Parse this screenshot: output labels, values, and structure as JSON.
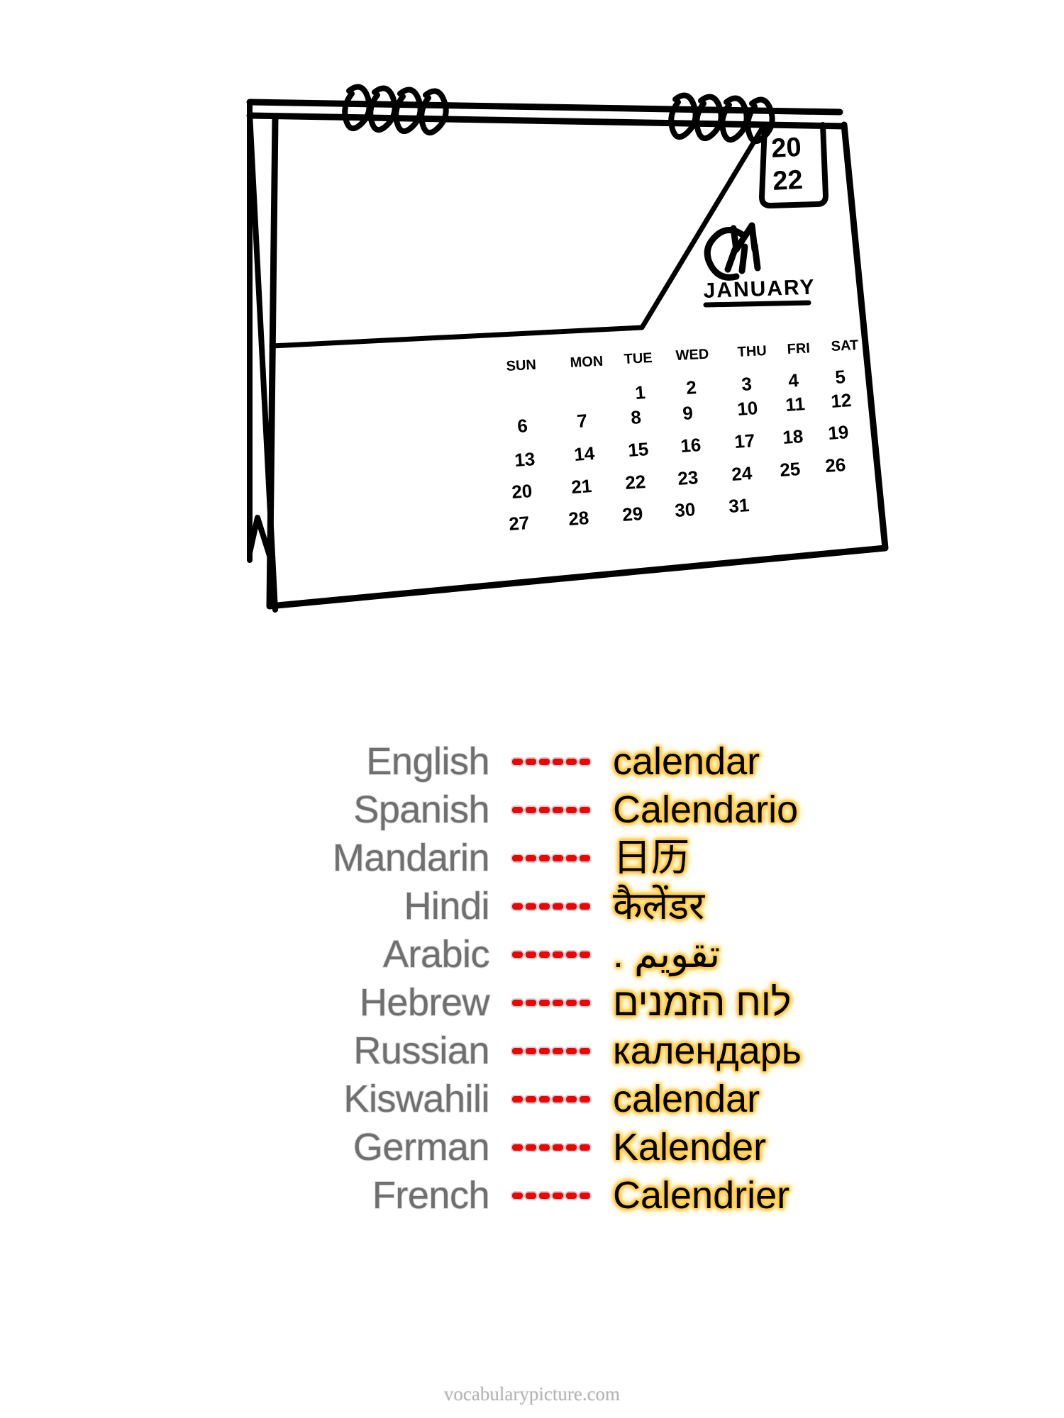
{
  "illustration": {
    "name": "hand-drawn-desk-calendar",
    "year_tab": "20\n22",
    "logo_text": "CM",
    "month": "JANUARY",
    "weekday_headers": [
      "SUN",
      "MON",
      "TUE",
      "WED",
      "THU",
      "FRI",
      "SAT"
    ],
    "weeks": [
      [
        "",
        "",
        "1",
        "2",
        "3",
        "4",
        "5"
      ],
      [
        "6",
        "7",
        "8",
        "9",
        "10",
        "11",
        "12"
      ],
      [
        "13",
        "14",
        "15",
        "16",
        "17",
        "18",
        "19"
      ],
      [
        "20",
        "21",
        "22",
        "23",
        "24",
        "25",
        "26"
      ],
      [
        "27",
        "28",
        "29",
        "30",
        "31",
        "",
        ""
      ]
    ],
    "ink_color": "#000000"
  },
  "word_list": {
    "separator_dash_count": 6,
    "dash_color": "#f40000",
    "label_color": "#6f6f6f",
    "word_glow_color": "#ffc83c",
    "rows": [
      {
        "language": "English",
        "word": "calendar",
        "rtl": false
      },
      {
        "language": "Spanish",
        "word": "Calendario",
        "rtl": false
      },
      {
        "language": "Mandarin",
        "word": "日历",
        "rtl": false
      },
      {
        "language": "Hindi",
        "word": "कैलेंडर",
        "rtl": false
      },
      {
        "language": "Arabic",
        "word": "تقويم .",
        "rtl": true
      },
      {
        "language": "Hebrew",
        "word": "לוח הזמנים",
        "rtl": true
      },
      {
        "language": "Russian",
        "word": "календарь",
        "rtl": false
      },
      {
        "language": "Kiswahili",
        "word": "calendar",
        "rtl": false
      },
      {
        "language": "German",
        "word": "Kalender",
        "rtl": false
      },
      {
        "language": "French",
        "word": "Calendrier",
        "rtl": false
      }
    ]
  },
  "footer": {
    "site": "vocabularypicture.com"
  }
}
